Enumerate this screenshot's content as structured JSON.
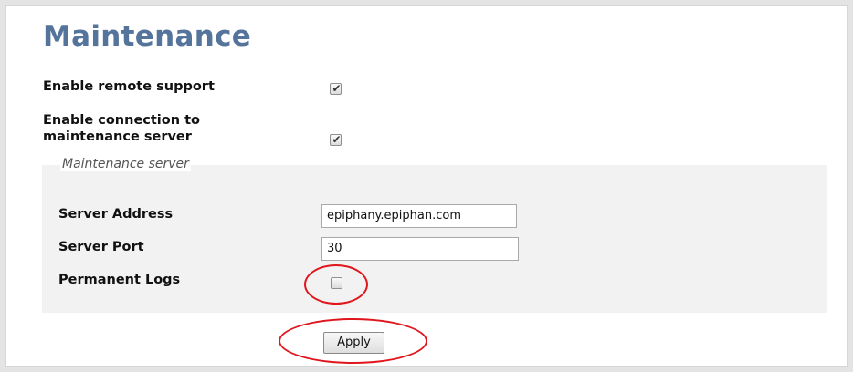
{
  "page": {
    "title": "Maintenance"
  },
  "settings": {
    "remote_support_label": "Enable remote support",
    "remote_support_checked": true,
    "connection_label_line1": "Enable connection to",
    "connection_label_line2": "maintenance server",
    "connection_checked": true
  },
  "maintenance_server": {
    "legend": "Maintenance server",
    "address_label": "Server Address",
    "address_value": "epiphany.epiphan.com",
    "port_label": "Server Port",
    "port_value": "30",
    "logs_label": "Permanent Logs",
    "logs_checked": false
  },
  "actions": {
    "apply_label": "Apply"
  },
  "colors": {
    "title": "#54749c",
    "highlight": "#e0161d",
    "panel": "#f2f2f2"
  }
}
